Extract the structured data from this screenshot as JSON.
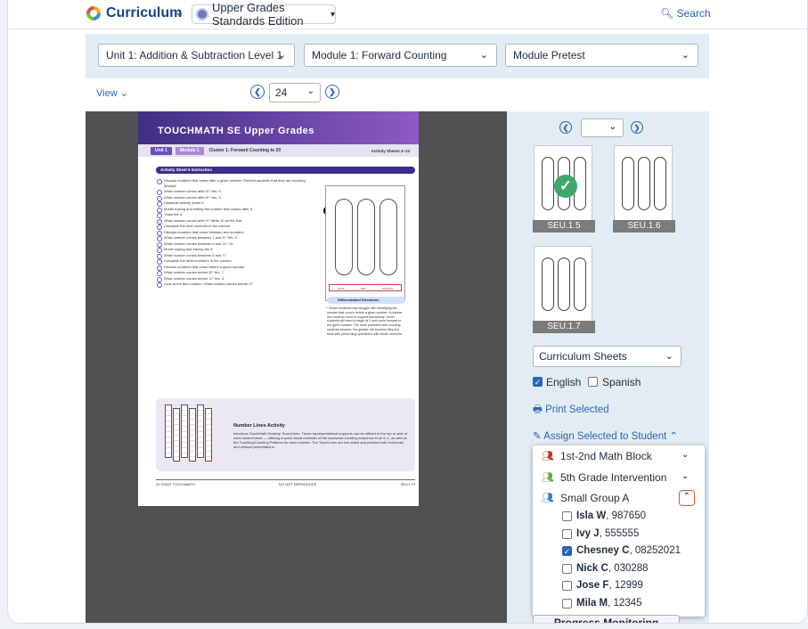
{
  "header": {
    "app_title": "Curriculum",
    "edition": "Upper Grades Standards Edition",
    "search": "Search"
  },
  "filters": {
    "unit": "Unit 1: Addition & Subtraction Level 1",
    "module": "Module 1: Forward Counting",
    "assessment": "Module Pretest"
  },
  "viewer": {
    "view_label": "View",
    "page": "24"
  },
  "document": {
    "brand": "TOUCHMATH SE Upper Grades",
    "unit_chip": "Unit 1",
    "module_chip": "Module 1",
    "cluster": "Cluster 1: Forward Counting to 20",
    "sheets_range": "Activity Sheets 4–14",
    "section": "Activity Sheet 5 Instruction",
    "lines": [
      "Discuss numbers that come after a given number. Remind students that they are counting forward.",
      "What number comes after 5? Yes, 6.",
      "What number comes after 8? Yes, 9.",
      "Distribute activity sheet 5.",
      "Model tracing and writing the number that comes after 5.",
      "Trace the 4.",
      "What number comes after 9? Write 10 on the line.",
      "Complete the next numbers in the column.",
      "Discuss numbers that come between two numbers.",
      "What number comes between 1 and 3? Yes, 2.",
      "What number comes between 9 and 11? 10.",
      "Model saying and tracing the 8.",
      "What number comes between 5 and 7?",
      "Complete the other numbers in the column.",
      "Discuss numbers that come before a given number.",
      "What number comes before 8? Yes, 7.",
      "What number comes before 4? Yes, 3.",
      "Look at the third column. What number comes before 2?"
    ],
    "sheet_words": [
      "nine",
      "ten",
      "eleven"
    ],
    "sheet_number": "5",
    "diff_title": "Differentiated Directions",
    "diff_body": "* Some students may struggle with identifying the number that comes before a given number. A number line could be used to support this activity. Some students will need to begin at 1 and count forward to the given number. The more proficient with counting students become, the greater the success they will have with performing operations with whole numbers.",
    "nl_title": "Number Lines Activity",
    "nl_body": "Introduce TouchMath Desktop TouchLines. These representational supports can be affixed to the top or side of each student desk — offering a quick visual reminder of the backward counting sequence from 9–1, as well as the Touching/Counting Patterns for each number. The TouchLines are two-sided and present both horizontal and vertical presentations.",
    "footer_left": "24  ©2022 TOUCHMATH",
    "footer_mid": "DO NOT REPRODUCE",
    "footer_right": "SEU1.T0"
  },
  "thumbs": [
    {
      "label": "SEU.1.5",
      "selected": true
    },
    {
      "label": "SEU.1.6",
      "selected": false
    },
    {
      "label": "SEU.1.7",
      "selected": false
    }
  ],
  "panel": {
    "sheet_type": "Curriculum Sheets",
    "english": "English",
    "spanish": "Spanish",
    "print": "Print Selected",
    "assign": "Assign Selected to Student"
  },
  "groups": [
    {
      "name": "1st-2nd Math Block",
      "color": "#c0392b"
    },
    {
      "name": "5th Grade Intervention",
      "color": "#6aa84f"
    },
    {
      "name": "Small Group A",
      "color": "#3b7fc4"
    }
  ],
  "students": [
    {
      "name": "Isla W",
      "id": "987650",
      "checked": false
    },
    {
      "name": "Ivy J",
      "id": "555555",
      "checked": false
    },
    {
      "name": "Chesney C",
      "id": "08252021",
      "checked": true
    },
    {
      "name": "Nick C",
      "id": "030288",
      "checked": false
    },
    {
      "name": "Jose F",
      "id": "12999",
      "checked": false
    },
    {
      "name": "Mila M",
      "id": "12345",
      "checked": false
    }
  ],
  "bottom_button": "Progress Monitoring"
}
